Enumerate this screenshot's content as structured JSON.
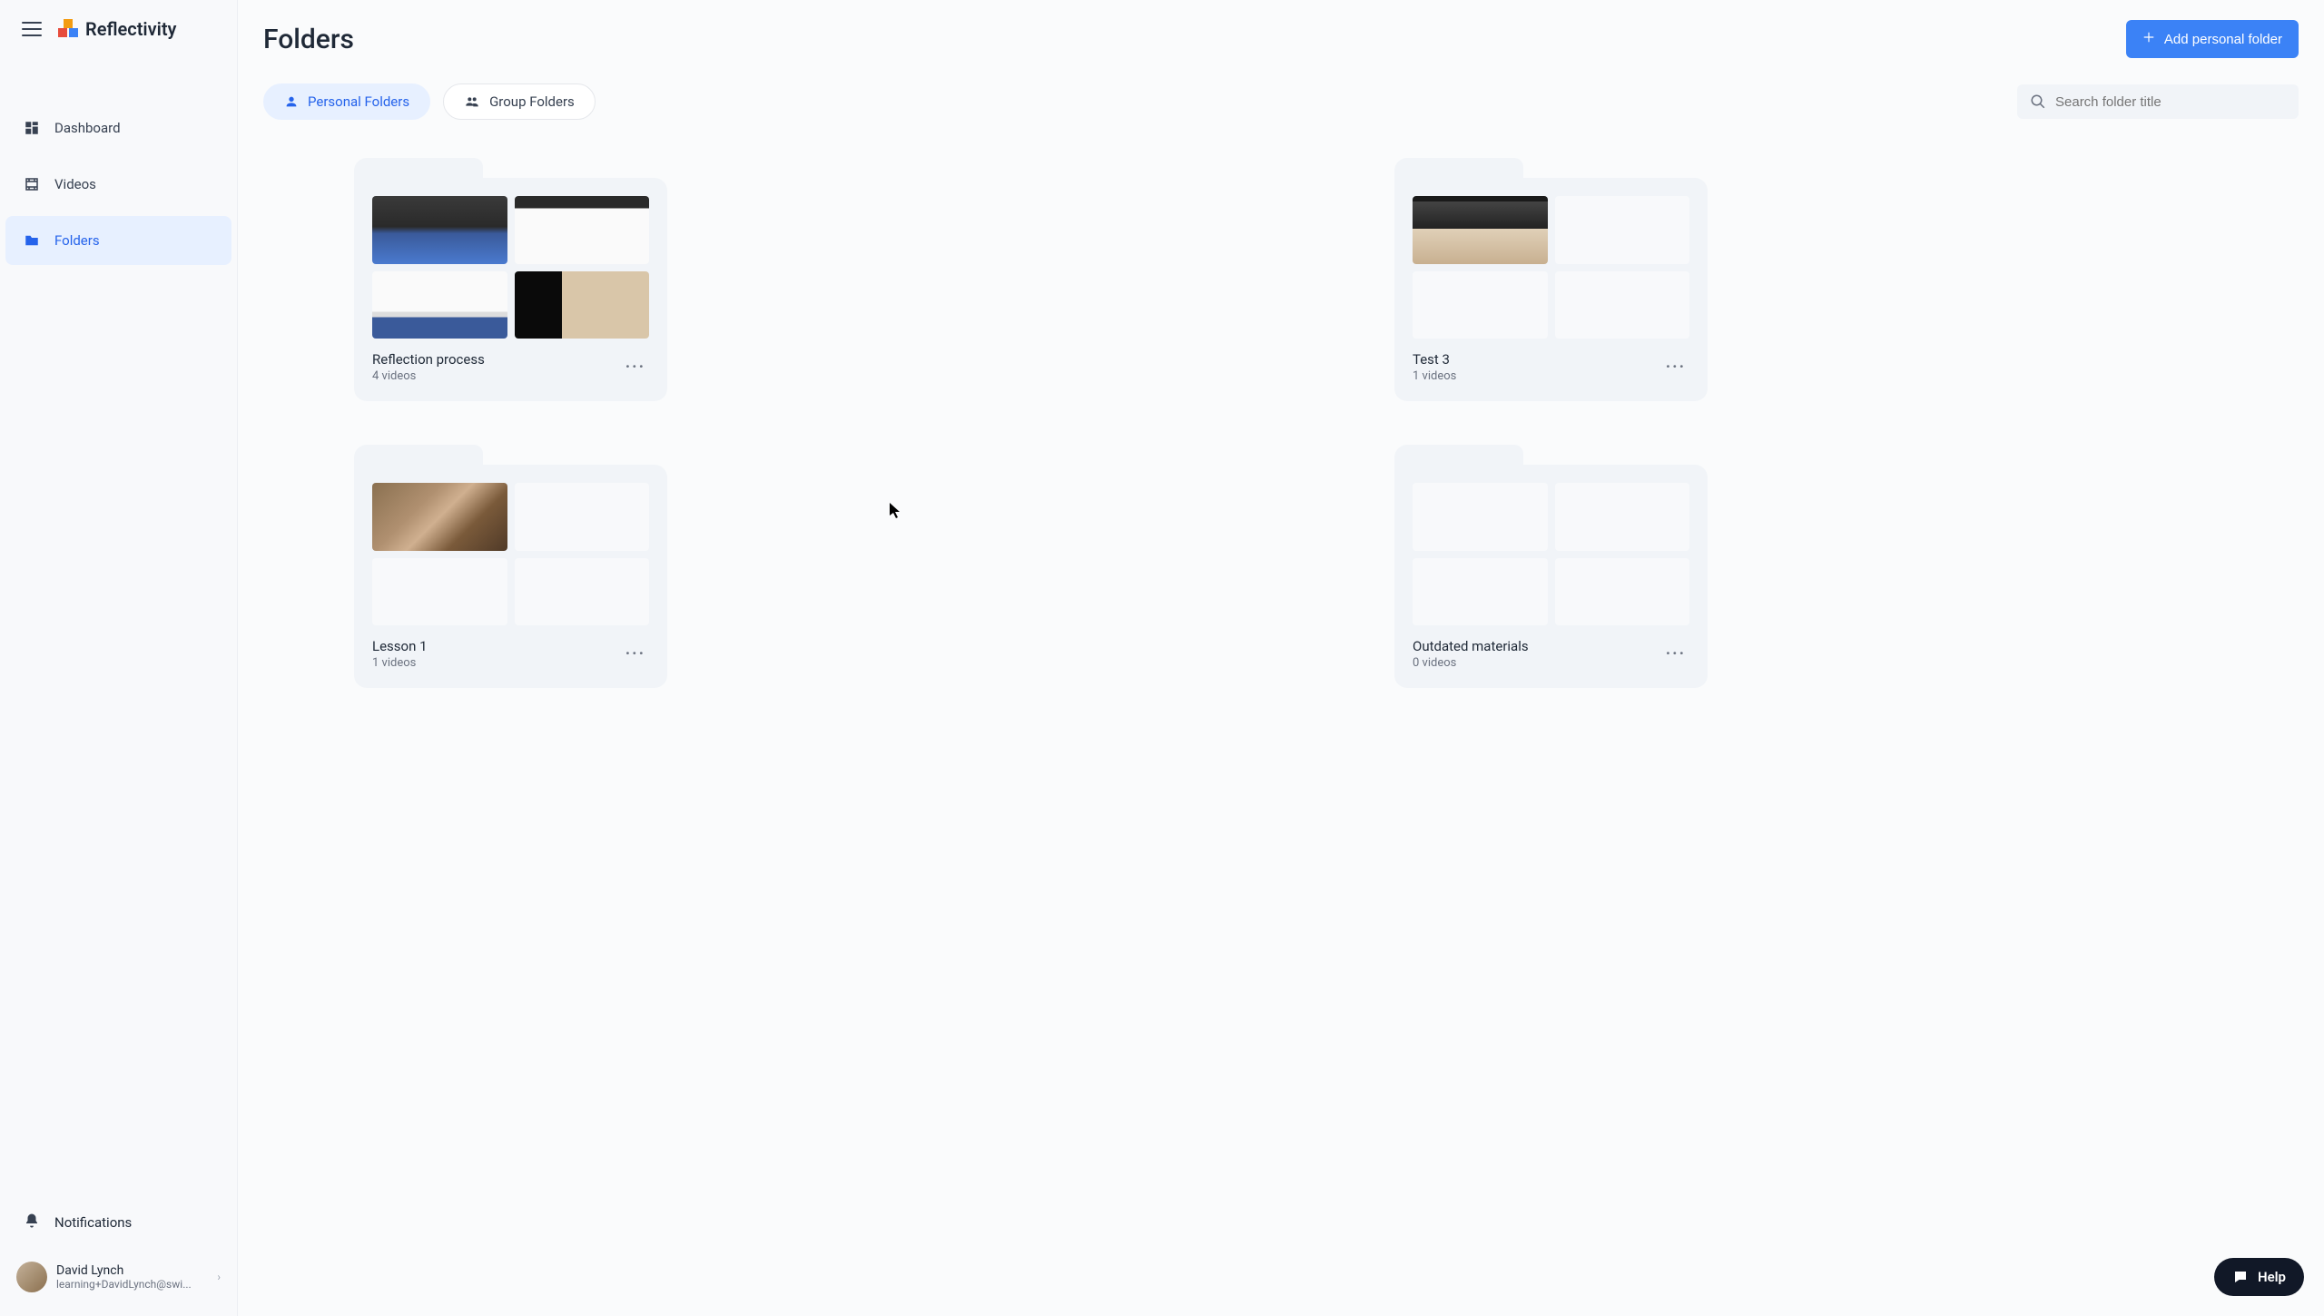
{
  "brand": {
    "name": "Reflectivity"
  },
  "sidebar": {
    "items": [
      {
        "label": "Dashboard",
        "name": "sidebar-item-dashboard",
        "icon": "dashboard-icon",
        "active": false
      },
      {
        "label": "Videos",
        "name": "sidebar-item-videos",
        "icon": "film-icon",
        "active": false
      },
      {
        "label": "Folders",
        "name": "sidebar-item-folders",
        "icon": "folder-icon",
        "active": true
      }
    ],
    "notifications_label": "Notifications"
  },
  "user": {
    "name": "David Lynch",
    "email": "learning+DavidLynch@swi..."
  },
  "page": {
    "title": "Folders",
    "add_button_label": "Add personal folder"
  },
  "tabs": [
    {
      "label": "Personal Folders",
      "name": "tab-personal-folders",
      "icon": "person-icon",
      "active": true
    },
    {
      "label": "Group Folders",
      "name": "tab-group-folders",
      "icon": "group-icon",
      "active": false
    }
  ],
  "search": {
    "placeholder": "Search folder title"
  },
  "folders": [
    {
      "title": "Reflection process",
      "count": "4 videos",
      "thumbs": [
        "t1a",
        "t1b",
        "t1c",
        "t1d"
      ]
    },
    {
      "title": "Test 3",
      "count": "1 videos",
      "thumbs": [
        "t2a",
        "",
        "",
        ""
      ]
    },
    {
      "title": "Lesson 1",
      "count": "1 videos",
      "thumbs": [
        "t3a",
        "",
        "",
        ""
      ]
    },
    {
      "title": "Outdated materials",
      "count": "0 videos",
      "thumbs": [
        "",
        "",
        "",
        ""
      ]
    }
  ],
  "help": {
    "label": "Help"
  }
}
